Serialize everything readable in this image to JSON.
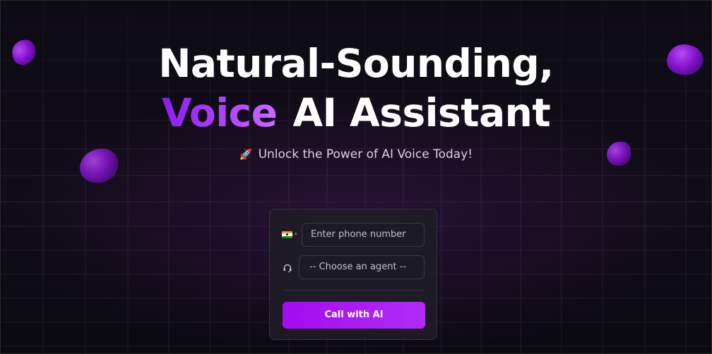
{
  "hero": {
    "headline_line1": "Natural-Sounding,",
    "headline_accent": "Voice",
    "headline_line2_rest": "AI Assistant",
    "tagline_icon": "rocket-icon",
    "tagline_emoji": "🚀",
    "tagline": "Unlock the Power of AI Voice Today!"
  },
  "form": {
    "country_flag": "india-flag-icon",
    "phone_placeholder": "Enter phone number",
    "agent_icon": "headset-icon",
    "agent_select_value": "-- Choose an agent --",
    "call_button_label": "Call with AI"
  },
  "colors": {
    "background": "#0b0a10",
    "accent_purple": "#a30cf2",
    "card_background": "#1e1c26",
    "text_primary": "#ffffff",
    "text_secondary": "#d9d3e2"
  }
}
